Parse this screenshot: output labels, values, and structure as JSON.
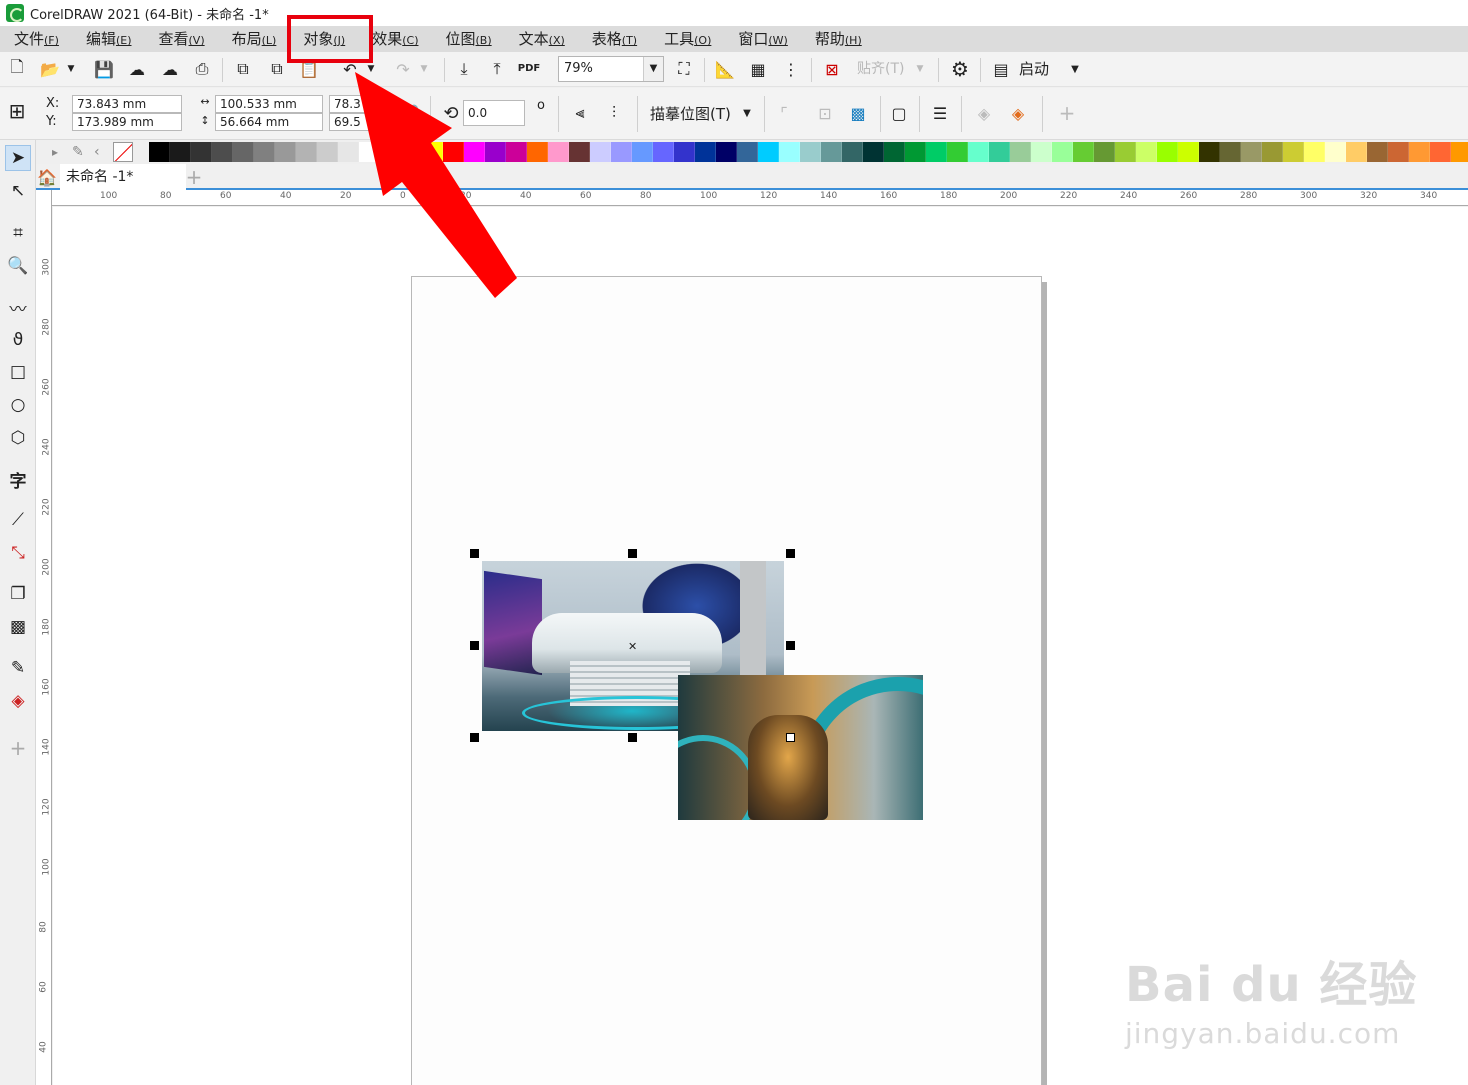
{
  "window": {
    "title": "CorelDRAW 2021 (64-Bit) - 未命名 -1*"
  },
  "menu": [
    {
      "label": "文件",
      "accel": "(F)"
    },
    {
      "label": "编辑",
      "accel": "(E)"
    },
    {
      "label": "查看",
      "accel": "(V)"
    },
    {
      "label": "布局",
      "accel": "(L)"
    },
    {
      "label": "对象",
      "accel": "(J)"
    },
    {
      "label": "效果",
      "accel": "(C)"
    },
    {
      "label": "位图",
      "accel": "(B)"
    },
    {
      "label": "文本",
      "accel": "(X)"
    },
    {
      "label": "表格",
      "accel": "(T)"
    },
    {
      "label": "工具",
      "accel": "(O)"
    },
    {
      "label": "窗口",
      "accel": "(W)"
    },
    {
      "label": "帮助",
      "accel": "(H)"
    }
  ],
  "toolbar": {
    "zoom": "79%",
    "pdf_label": "PDF",
    "snap_label": "贴齐(T)",
    "launch_label": "启动"
  },
  "property_bar": {
    "x_label": "X:",
    "y_label": "Y:",
    "x_value": "73.843 mm",
    "y_value": "173.989 mm",
    "width_value": "100.533 mm",
    "height_value": "56.664 mm",
    "scale_x": "78.3",
    "scale_y": "69.5",
    "percent": "%",
    "rotation": "0.0",
    "degree": "o",
    "trace_bitmap": "描摹位图(T)"
  },
  "tabs": {
    "document": "未命名 -1*"
  },
  "ruler": {
    "h_ticks": [
      "100",
      "80",
      "60",
      "40",
      "20",
      "0",
      "20",
      "40",
      "60",
      "80",
      "100",
      "120",
      "140",
      "160",
      "180",
      "200",
      "220",
      "240",
      "260",
      "280",
      "300",
      "320",
      "340"
    ],
    "v_ticks": [
      "300",
      "280",
      "260",
      "240",
      "220",
      "200",
      "180",
      "160",
      "140",
      "120",
      "100",
      "80",
      "60",
      "40"
    ]
  },
  "colors": {
    "highlight": "#e8000d",
    "accent": "#3c8fd8",
    "palette": [
      "#000000",
      "#1a1a1a",
      "#333333",
      "#4d4d4d",
      "#666666",
      "#808080",
      "#999999",
      "#b3b3b3",
      "#cccccc",
      "#e6e6e6",
      "#ffffff",
      "#0000ff",
      "#00b7ff",
      "#ffff00",
      "#ff0000",
      "#ff00ff",
      "#9900cc",
      "#cc0099",
      "#ff6600",
      "#ff99cc",
      "#663333",
      "#ccccff",
      "#9999ff",
      "#6699ff",
      "#6666ff",
      "#3333cc",
      "#003399",
      "#000066",
      "#336699",
      "#00ccff",
      "#99ffff",
      "#99cccc",
      "#669999",
      "#336666",
      "#003333",
      "#006633",
      "#009933",
      "#00cc66",
      "#33cc33",
      "#66ffcc",
      "#33cc99",
      "#99cc99",
      "#ccffcc",
      "#99ff99",
      "#66cc33",
      "#669933",
      "#99cc33",
      "#ccff66",
      "#99ff00",
      "#ccff00",
      "#333300",
      "#666633",
      "#999966",
      "#999933",
      "#cccc33",
      "#ffff66",
      "#ffffcc",
      "#ffcc66",
      "#996633",
      "#cc6633",
      "#ff9933",
      "#ff6633",
      "#ff9900"
    ]
  },
  "watermark": {
    "main": "Bai du 经验",
    "sub": "jingyan.baidu.com"
  }
}
